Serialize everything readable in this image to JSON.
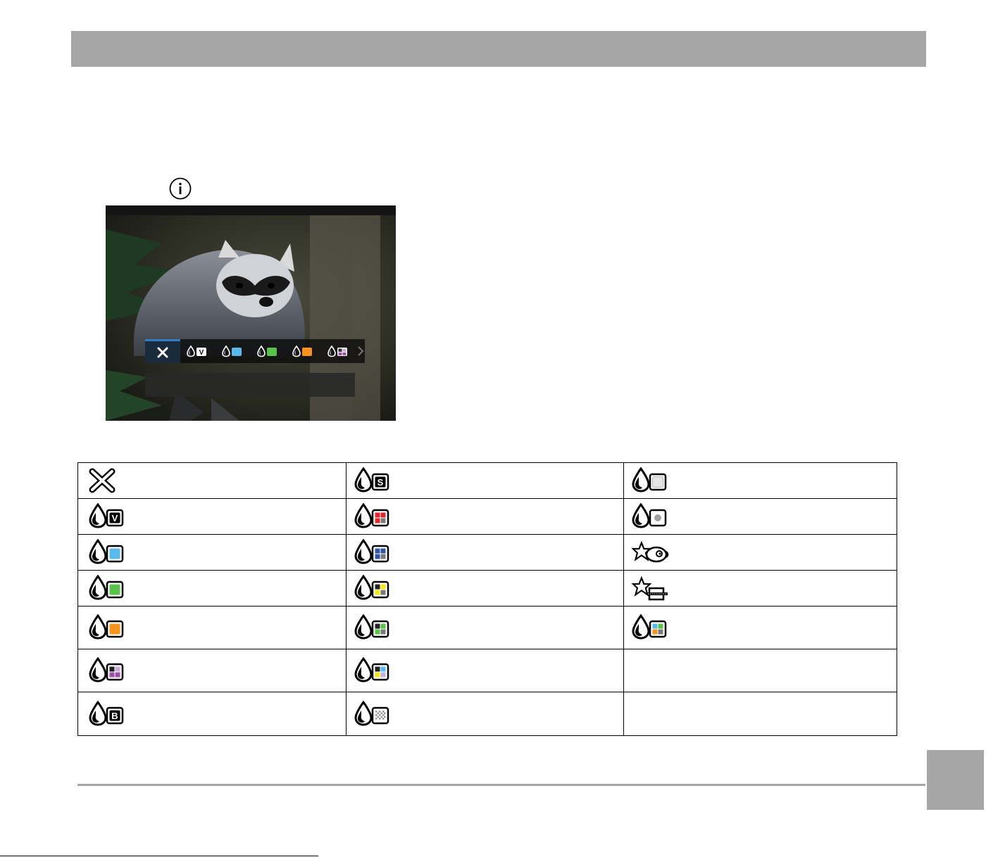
{
  "colors": {
    "header_bar": "#a6a6a6",
    "strip_selected": "#2f7fc6",
    "blue": "#5bb8ea",
    "green": "#58c24a",
    "orange": "#f7921e",
    "purple": "#9b4fa5",
    "red": "#e0262b",
    "navy": "#3055a5",
    "yellow": "#f4e716",
    "grey": "#7a7a7a"
  },
  "screen": {
    "strip_items": [
      {
        "icon": "close-icon"
      },
      {
        "icon": "vivid-effect-icon",
        "badge": "V"
      },
      {
        "icon": "blue-effect-icon"
      },
      {
        "icon": "green-effect-icon"
      },
      {
        "icon": "orange-effect-icon"
      },
      {
        "icon": "purple-effect-icon"
      }
    ]
  },
  "table": {
    "rows": [
      [
        {
          "icon": "close-icon"
        },
        {
          "icon": "sepia-effect-icon",
          "badge": "S"
        },
        {
          "icon": "dreamy-effect-icon"
        }
      ],
      [
        {
          "icon": "vivid-effect-icon",
          "badge": "V"
        },
        {
          "icon": "red-effect-icon"
        },
        {
          "icon": "vignetting-effect-icon"
        }
      ],
      [
        {
          "icon": "blue-effect-icon"
        },
        {
          "icon": "blue-partial-effect-icon"
        },
        {
          "icon": "fisheye-effect-icon"
        }
      ],
      [
        {
          "icon": "green-effect-icon"
        },
        {
          "icon": "yellow-partial-effect-icon"
        },
        {
          "icon": "miniature-effect-icon"
        }
      ],
      [
        {
          "icon": "orange-effect-icon"
        },
        {
          "icon": "green-partial-effect-icon"
        },
        {
          "icon": "multi-color-effect-icon"
        }
      ],
      [
        {
          "icon": "purple-effect-icon"
        },
        {
          "icon": "mixed-partial-effect-icon"
        },
        {}
      ],
      [
        {
          "icon": "black-white-effect-icon",
          "badge": "B"
        },
        {
          "icon": "negative-effect-icon"
        },
        {}
      ]
    ]
  }
}
